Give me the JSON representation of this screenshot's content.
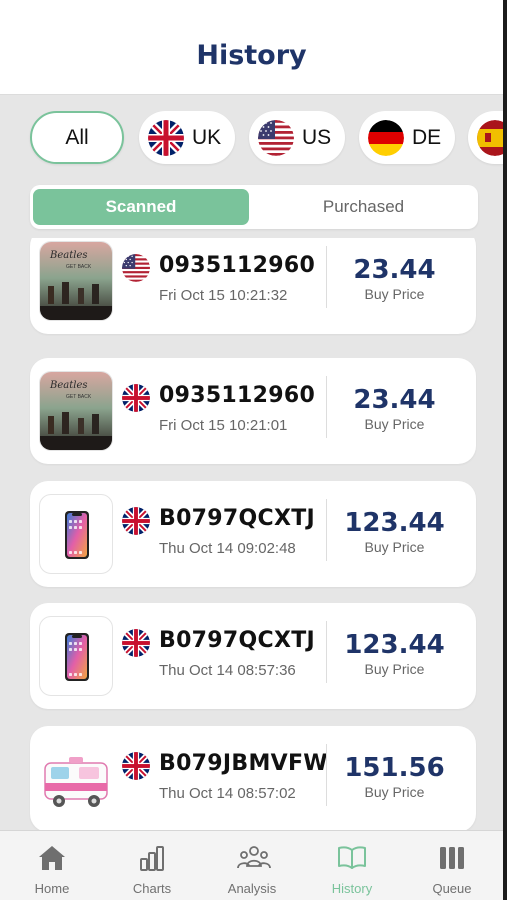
{
  "header": {
    "title": "History"
  },
  "countries": [
    {
      "label": "All",
      "active": true
    },
    {
      "label": "UK",
      "flag": "uk-flag"
    },
    {
      "label": "US",
      "flag": "us-flag"
    },
    {
      "label": "DE",
      "flag": "de-flag"
    },
    {
      "label": "",
      "flag": "es-flag"
    }
  ],
  "segments": {
    "scanned": "Scanned",
    "purchased": "Purchased",
    "active": "scanned"
  },
  "items": [
    {
      "thumb": "beatles-get-back-cover",
      "flag": "us-flag",
      "code": "0935112960",
      "date": "Fri Oct 15 10:21:32",
      "price": "23.44",
      "price_label": "Buy Price"
    },
    {
      "thumb": "beatles-get-back-cover",
      "flag": "uk-flag",
      "code": "0935112960",
      "date": "Fri Oct 15 10:21:01",
      "price": "23.44",
      "price_label": "Buy Price"
    },
    {
      "thumb": "iphone-x-image",
      "flag": "uk-flag",
      "code": "B0797QCXTJ",
      "date": "Thu Oct 14 09:02:48",
      "price": "123.44",
      "price_label": "Buy Price"
    },
    {
      "thumb": "iphone-x-image",
      "flag": "uk-flag",
      "code": "B0797QCXTJ",
      "date": "Thu Oct 14 08:57:36",
      "price": "123.44",
      "price_label": "Buy Price"
    },
    {
      "thumb": "toy-ambulance-image",
      "flag": "uk-flag",
      "code": "B079JBMVFW",
      "date": "Thu Oct 14 08:57:02",
      "price": "151.56",
      "price_label": "Buy Price"
    }
  ],
  "tabs": [
    {
      "label": "Home",
      "icon": "home-icon"
    },
    {
      "label": "Charts",
      "icon": "bar-chart-icon"
    },
    {
      "label": "Analysis",
      "icon": "people-group-icon"
    },
    {
      "label": "History",
      "icon": "open-book-icon",
      "active": true
    },
    {
      "label": "Queue",
      "icon": "queue-columns-icon"
    }
  ],
  "colors": {
    "accent": "#7ac39b",
    "navy": "#1f3468",
    "background": "#e6e6e6"
  }
}
